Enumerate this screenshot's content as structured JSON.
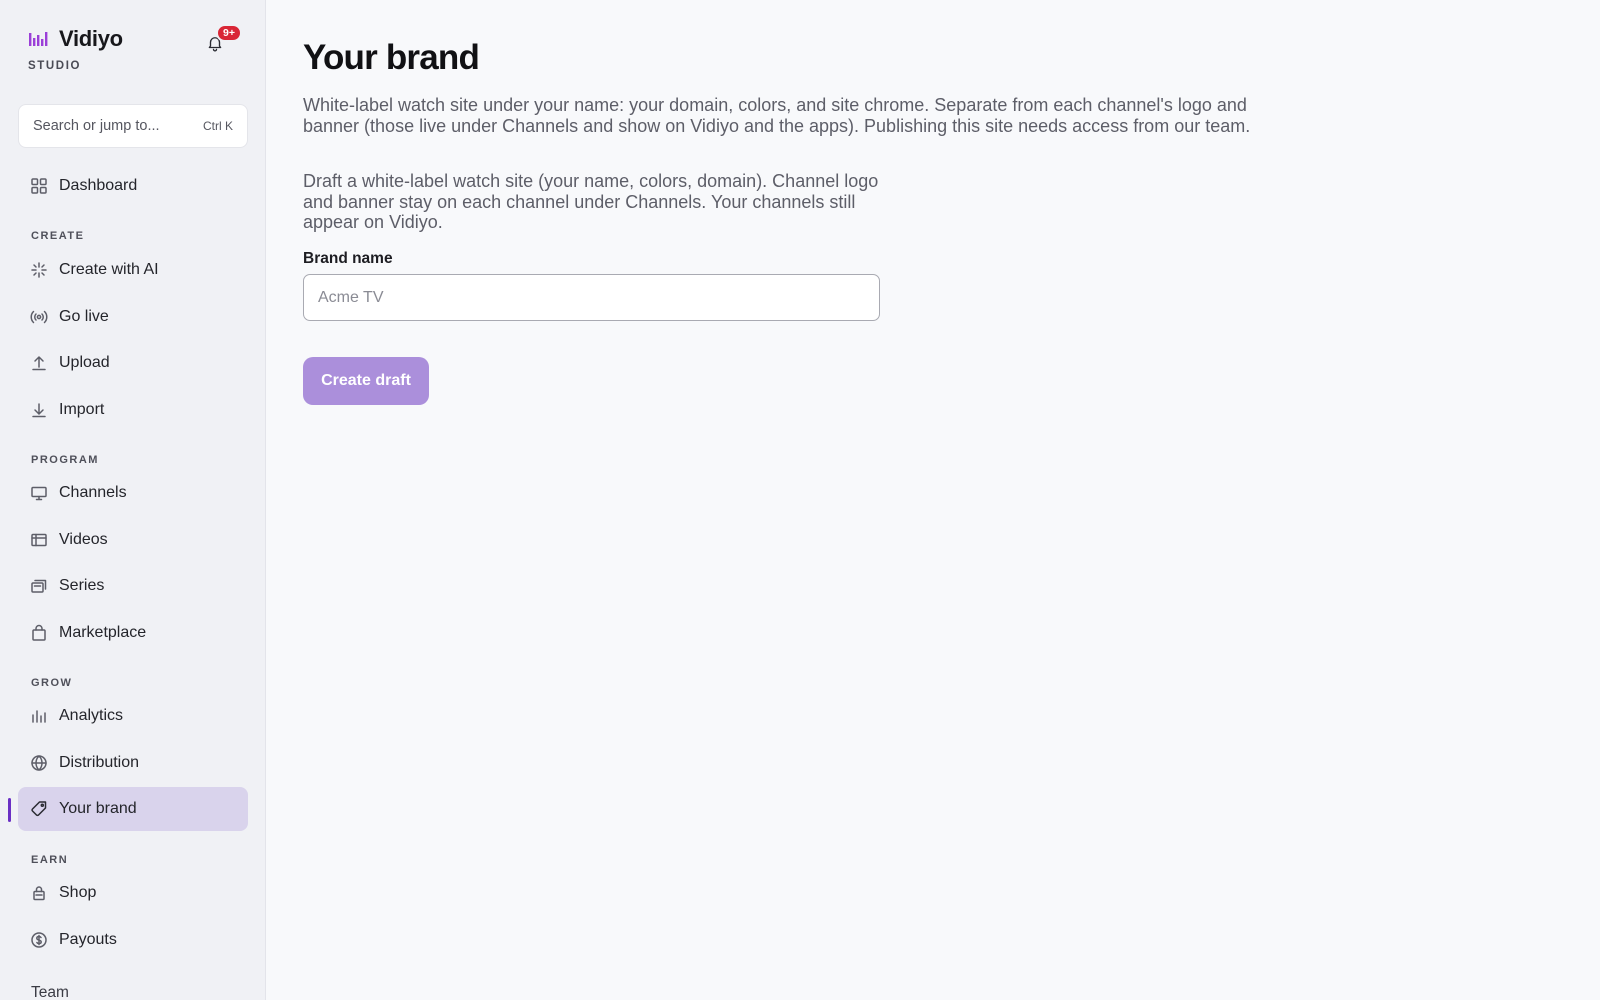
{
  "app": {
    "name": "Vidiyo",
    "subtitle": "STUDIO",
    "notification_badge": "9+",
    "accent_color": "#6a2fc4"
  },
  "search": {
    "placeholder": "Search or jump to...",
    "shortcut": "Ctrl K"
  },
  "sidebar": {
    "dashboard": {
      "label": "Dashboard",
      "icon": "grid-icon"
    },
    "sections": {
      "create": "CREATE",
      "program": "PROGRAM",
      "grow": "GROW",
      "earn": "EARN"
    },
    "create_items": [
      {
        "label": "Create with AI",
        "icon": "sparkle-icon"
      },
      {
        "label": "Go live",
        "icon": "broadcast-icon"
      },
      {
        "label": "Upload",
        "icon": "upload-icon"
      },
      {
        "label": "Import",
        "icon": "download-icon"
      }
    ],
    "program_items": [
      {
        "label": "Channels",
        "icon": "monitor-icon"
      },
      {
        "label": "Videos",
        "icon": "film-icon"
      },
      {
        "label": "Series",
        "icon": "stack-icon"
      },
      {
        "label": "Marketplace",
        "icon": "bag-icon"
      }
    ],
    "grow_items": [
      {
        "label": "Analytics",
        "icon": "bar-chart-icon"
      },
      {
        "label": "Distribution",
        "icon": "globe-icon"
      },
      {
        "label": "Your brand",
        "icon": "tag-icon",
        "active": true
      }
    ],
    "earn_items": [
      {
        "label": "Shop",
        "icon": "lock-bag-icon"
      },
      {
        "label": "Payouts",
        "icon": "dollar-circle-icon"
      }
    ],
    "team_label": "Team"
  },
  "main": {
    "title": "Your brand",
    "description": "White-label watch site under your name: your domain, colors, and site chrome. Separate from each channel's logo and banner (those live under Channels and show on Vidiyo and the apps). Publishing this site needs access from our team.",
    "draft_description": "Draft a white-label watch site (your name, colors, domain). Channel logo and banner stay on each channel under Channels. Your channels still appear on Vidiyo.",
    "brand_name_label": "Brand name",
    "brand_name_placeholder": "Acme TV",
    "brand_name_value": "",
    "create_button": "Create draft"
  }
}
